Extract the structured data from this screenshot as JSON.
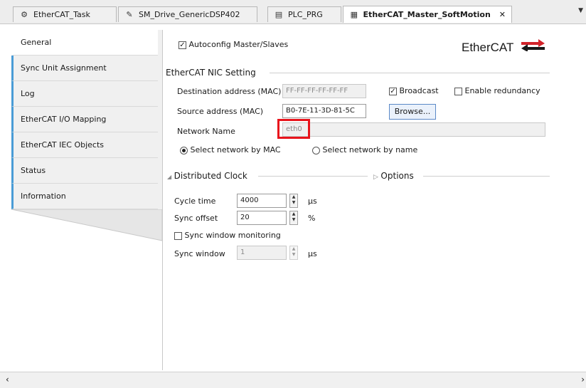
{
  "tabs": [
    {
      "label": "EtherCAT_Task",
      "icon": "task-icon"
    },
    {
      "label": "SM_Drive_GenericDSP402",
      "icon": "drive-icon"
    },
    {
      "label": "PLC_PRG",
      "icon": "program-icon"
    },
    {
      "label": "EtherCAT_Master_SoftMotion",
      "icon": "master-icon",
      "active": true
    }
  ],
  "nav": [
    {
      "label": "General",
      "active": true
    },
    {
      "label": "Sync Unit Assignment"
    },
    {
      "label": "Log"
    },
    {
      "label": "EtherCAT I/O Mapping"
    },
    {
      "label": "EtherCAT IEC Objects"
    },
    {
      "label": "Status"
    },
    {
      "label": "Information"
    }
  ],
  "general": {
    "autoconfig_label": "Autoconfig Master/Slaves",
    "autoconfig_checked": true,
    "logo_text": "EtherCAT",
    "nic_title": "EtherCAT NIC Setting",
    "dest_label": "Destination address (MAC)",
    "dest_value": "FF-FF-FF-FF-FF-FF",
    "broadcast_label": "Broadcast",
    "broadcast_checked": true,
    "redundancy_label": "Enable redundancy",
    "redundancy_checked": false,
    "source_label": "Source address (MAC)",
    "source_value": "B0-7E-11-3D-81-5C",
    "browse_label": "Browse...",
    "netname_label": "Network Name",
    "netname_value": "eth0",
    "select_mac_label": "Select network by MAC",
    "select_name_label": "Select network by name"
  },
  "dc": {
    "title": "Distributed Clock",
    "options_label": "Options",
    "cycle_label": "Cycle time",
    "cycle_value": "4000",
    "cycle_unit": "µs",
    "offset_label": "Sync offset",
    "offset_value": "20",
    "offset_unit": "%",
    "syncmon_label": "Sync window monitoring",
    "syncmon_checked": false,
    "window_label": "Sync window",
    "window_value": "1",
    "window_unit": "µs"
  },
  "colors": {
    "accent": "#4a9cd6",
    "highlight": "#e8141c",
    "logo_red": "#d2232a"
  }
}
